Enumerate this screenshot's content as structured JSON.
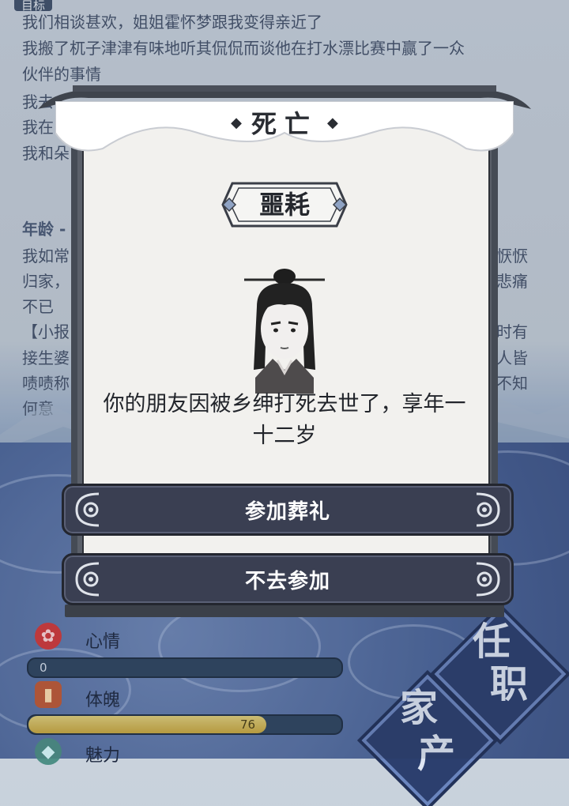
{
  "background": {
    "tab_label": "目标",
    "log_lines": [
      "我们相谈甚欢，姐姐霍怀梦跟我变得亲近了",
      "我搬了杌子津津有味地听其侃侃而谈他在打水漂比赛中赢了一众",
      "伙伴的事情",
      "我去",
      "我在",
      "我和朵",
      "年龄 -",
      "我如常",
      "归家，",
      "不已",
      "【小报",
      "接生婆",
      "啧啧称",
      "何意"
    ],
    "right_fragments": [
      "恹恹",
      "悲痛",
      "时有",
      "人皆",
      "不知"
    ],
    "stats": [
      {
        "label": "心情",
        "value": "0",
        "fill": 0.0,
        "icon": "flower-icon"
      },
      {
        "label": "体魄",
        "value": "76",
        "fill": 0.76,
        "icon": "hydrant-icon"
      },
      {
        "label": "魅力",
        "icon": "gem-icon"
      }
    ],
    "diamond_buttons": [
      {
        "text": "任\n职"
      },
      {
        "text": "家\n产"
      }
    ]
  },
  "dialog": {
    "title": "死亡",
    "badge": "噩耗",
    "message": "你的朋友因被乡绅打死去世了，享年一十二岁",
    "buttons": {
      "attend": "参加葬礼",
      "decline": "不去参加"
    }
  },
  "colors": {
    "button_bg": "#3a3f52",
    "paper": "#f2f1ee",
    "frame": "#454b55",
    "bar_fill": "#d4ba55"
  }
}
